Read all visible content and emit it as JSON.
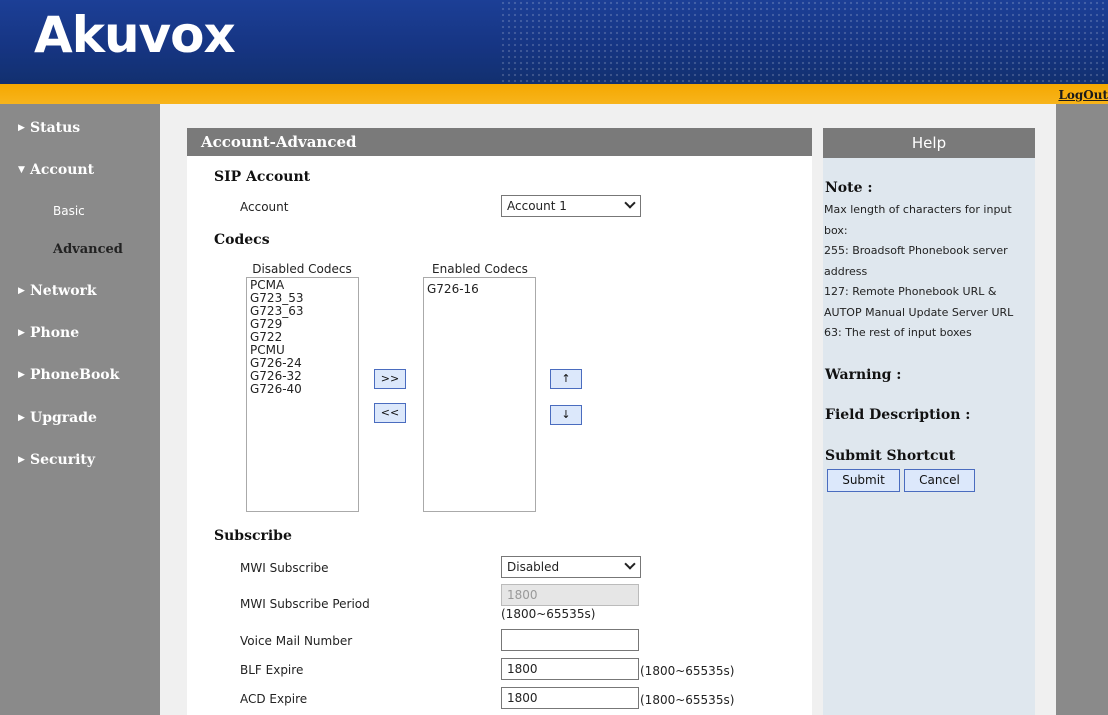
{
  "header": {
    "logo": "Akuvox",
    "logout": "LogOut"
  },
  "sidebar": {
    "items": [
      {
        "label": "Status"
      },
      {
        "label": "Account"
      },
      {
        "label": "Network"
      },
      {
        "label": "Phone"
      },
      {
        "label": "PhoneBook"
      },
      {
        "label": "Upgrade"
      },
      {
        "label": "Security"
      }
    ],
    "account_sub": [
      {
        "label": "Basic"
      },
      {
        "label": "Advanced"
      }
    ]
  },
  "main": {
    "title": "Account-Advanced",
    "sip_account": {
      "heading": "SIP Account",
      "account_label": "Account",
      "account_value": "Account 1"
    },
    "codecs": {
      "heading": "Codecs",
      "disabled_header": "Disabled Codecs",
      "enabled_header": "Enabled Codecs",
      "disabled": [
        "PCMA",
        "G723_53",
        "G723_63",
        "G729",
        "G722",
        "PCMU",
        "G726-24",
        "G726-32",
        "G726-40"
      ],
      "enabled": [
        "G726-16"
      ],
      "btn_add": ">>",
      "btn_remove": "<<",
      "btn_up": "↑",
      "btn_down": "↓"
    },
    "subscribe": {
      "heading": "Subscribe",
      "mwi_label": "MWI Subscribe",
      "mwi_value": "Disabled",
      "mwi_period_label": "MWI Subscribe Period",
      "mwi_period_value": "1800",
      "mwi_period_range": "(1800~65535s)",
      "voicemail_label": "Voice Mail Number",
      "voicemail_value": "",
      "blf_label": "BLF Expire",
      "blf_value": "1800",
      "blf_range": "(1800~65535s)",
      "acd_label": "ACD Expire",
      "acd_value": "1800",
      "acd_range": "(1800~65535s)"
    }
  },
  "help": {
    "title": "Help",
    "note_heading": "Note :",
    "note_lines": [
      "Max length of characters for input",
      "box:",
      "255: Broadsoft Phonebook server",
      "address",
      "127: Remote Phonebook URL &",
      "AUTOP Manual Update Server URL",
      "63: The rest of input boxes"
    ],
    "warning_heading": "Warning :",
    "field_desc_heading": "Field Description :",
    "submit_heading": "Submit Shortcut",
    "submit_label": "Submit",
    "cancel_label": "Cancel"
  },
  "colors": {
    "header_blue": "#1c3f96",
    "orange_bar": "#f6a800",
    "sidebar_grey": "#8a8a8a",
    "button_blue": "#dce8fb"
  }
}
